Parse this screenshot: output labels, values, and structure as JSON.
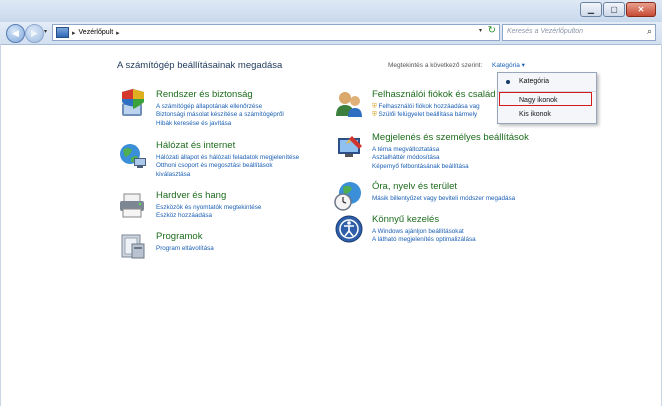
{
  "breadcrumb": {
    "location": "Vezérlőpult"
  },
  "search": {
    "placeholder": "Keresés a Vezérlőpulton"
  },
  "main": {
    "heading": "A számítógép beállításainak megadása",
    "view_by_label": "Megtekintés a következő szerint:",
    "view_by_value": "Kategória ▾"
  },
  "categories": [
    {
      "title": "Rendszer és biztonság",
      "icon": "shield-computer-icon",
      "links": [
        "A számítógép állapotának ellenőrzése",
        "Biztonsági másolat készítése a számítógépről",
        "Hibák keresése és javítása"
      ]
    },
    {
      "title": "Hálózat és internet",
      "icon": "network-globe-icon",
      "links": [
        "Hálózati állapot és hálózati feladatok megjelenítése",
        "Otthoni csoport és megosztási beállítások",
        "kiválasztása"
      ]
    },
    {
      "title": "Hardver és hang",
      "icon": "printer-icon",
      "links": [
        "Eszközök és nyomtatók megtekintése",
        "Eszköz hozzáadása"
      ]
    },
    {
      "title": "Programok",
      "icon": "programs-icon",
      "links": [
        "Program eltávolítása"
      ]
    },
    {
      "title": "Felhasználói fiókok és család",
      "icon": "users-icon",
      "links": [
        "Felhasználói fiókok hozzáadása vag",
        "Szülői felügyelet beállítása bármely"
      ]
    },
    {
      "title": "Megjelenés és személyes beállítások",
      "icon": "appearance-icon",
      "links": [
        "A téma megváltoztatása",
        "Asztalháttér módosítása",
        "Képernyő felbontásának beállítása"
      ]
    },
    {
      "title": "Óra, nyelv és terület",
      "icon": "clock-globe-icon",
      "links": [
        "Másik billentyűzet vagy beviteli módszer megadása"
      ]
    },
    {
      "title": "Könnyű kezelés",
      "icon": "ease-of-access-icon",
      "links": [
        "A Windows ajánljon beállításokat",
        "A látható megjelenítés optimalizálása"
      ]
    }
  ],
  "dropdown": {
    "items": [
      "Kategória",
      "Nagy ikonok",
      "Kis ikonok"
    ],
    "selected": "Kategória",
    "highlighted": "Nagy ikonok"
  },
  "colors": {
    "accent_link": "#1a5fb4",
    "category_title": "#1c6b1c",
    "highlight_border": "#d41a1a"
  }
}
